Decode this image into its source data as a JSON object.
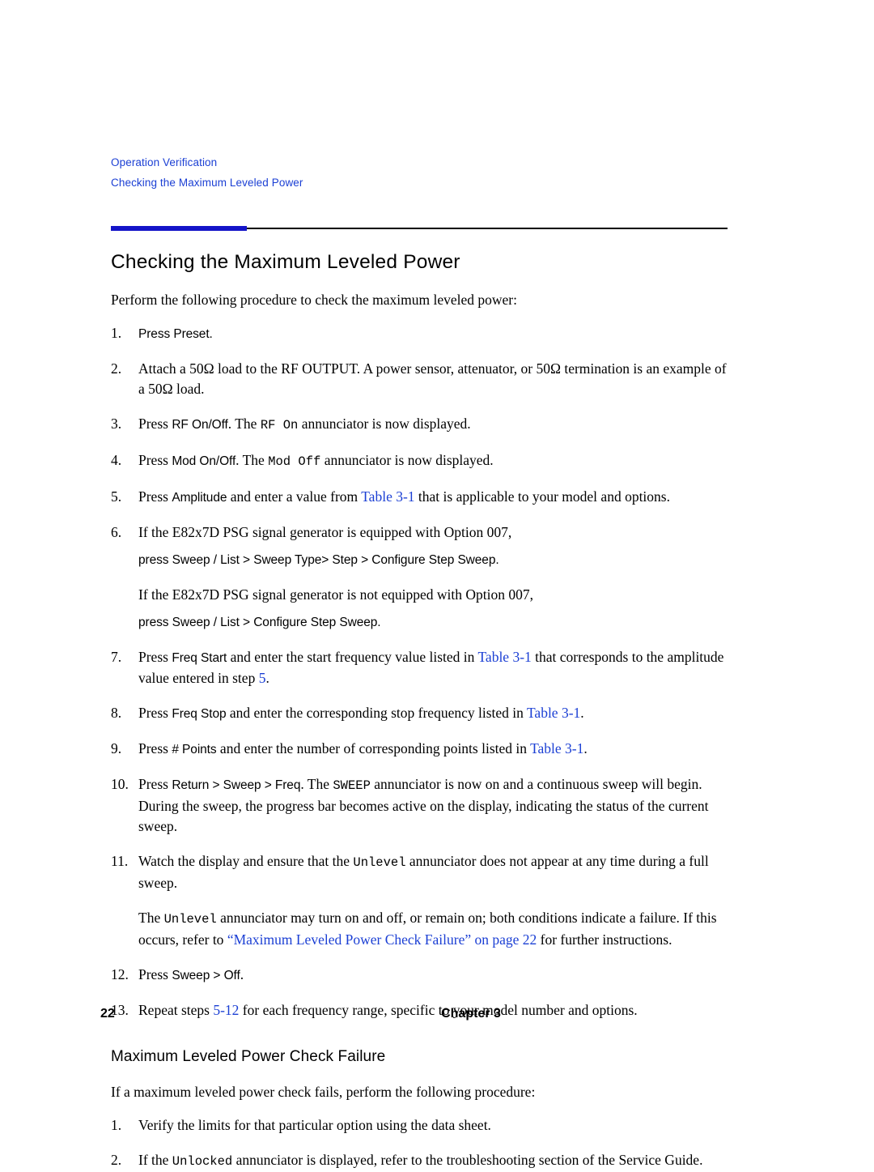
{
  "header": {
    "line1": "Operation Verification",
    "line2": "Checking the Maximum Leveled Power"
  },
  "title": "Checking the Maximum Leveled Power",
  "intro": "Perform the following procedure to check the maximum leveled power:",
  "steps": {
    "n1": "1.",
    "s1_a": "Press Preset.",
    "n2": "2.",
    "s2_a": "Attach a 50Ω load to the RF OUTPUT. A power sensor, attenuator, or 50Ω termination is an example of a 50Ω load.",
    "n3": "3.",
    "s3_a": "Press ",
    "s3_key": "RF On/Off",
    "s3_b": ". The ",
    "s3_mono": "RF On",
    "s3_c": " annunciator is now displayed.",
    "n4": "4.",
    "s4_a": "Press ",
    "s4_key": "Mod On/Off",
    "s4_b": ". The ",
    "s4_mono": "Mod Off",
    "s4_c": " annunciator is now displayed.",
    "n5": "5.",
    "s5_a": "Press ",
    "s5_key": "Amplitude",
    "s5_b": " and enter a value from ",
    "s5_link": "Table 3-1",
    "s5_c": " that is applicable to your model and options.",
    "n6": "6.",
    "s6_a": "If the E82x7D PSG signal generator is equipped with Option 007,",
    "s6_keys1": "press Sweep / List > Sweep Type> Step > Configure Step Sweep.",
    "s6_b": "If the E82x7D PSG signal generator is not equipped with Option 007,",
    "s6_keys2": "press Sweep / List > Configure Step Sweep.",
    "n7": "7.",
    "s7_a": "Press ",
    "s7_key": "Freq Start",
    "s7_b": " and enter the start frequency value listed in ",
    "s7_link": "Table 3-1",
    "s7_c": " that corresponds to the amplitude value entered in step ",
    "s7_link2": "5",
    "s7_d": ".",
    "n8": "8.",
    "s8_a": "Press ",
    "s8_key": "Freq Stop",
    "s8_b": " and enter the corresponding stop frequency listed in ",
    "s8_link": "Table 3-1",
    "s8_c": ".",
    "n9": "9.",
    "s9_a": "Press ",
    "s9_key": "# Points",
    "s9_b": " and enter the number of corresponding points listed in ",
    "s9_link": "Table 3-1",
    "s9_c": ".",
    "n10": "10.",
    "s10_a": "Press ",
    "s10_key": "Return > Sweep > Freq",
    "s10_b": ". The ",
    "s10_mono": "SWEEP",
    "s10_c": " annunciator is now on and a continuous sweep will begin. During the sweep, the progress bar becomes active on the display, indicating the status of the current sweep.",
    "n11": "11.",
    "s11_a": "Watch the display and ensure that the ",
    "s11_mono": "Unlevel",
    "s11_b": " annunciator does not appear at any time during a full sweep.",
    "s11_p2_a": "The ",
    "s11_p2_mono": "Unlevel",
    "s11_p2_b": " annunciator may turn on and off, or remain on; both conditions indicate a failure. If this occurs, refer to ",
    "s11_p2_link": "“Maximum Leveled Power Check Failure” on page 22",
    "s11_p2_c": " for further instructions.",
    "n12": "12.",
    "s12_a": "Press ",
    "s12_key": "Sweep > Off",
    "s12_b": ".",
    "n13": "13.",
    "s13_a": "Repeat steps ",
    "s13_link": "5-12",
    "s13_b": " for each frequency range, specific to your model number and options."
  },
  "subsection": {
    "title": "Maximum Leveled Power Check Failure",
    "intro": "If a maximum leveled power check fails, perform the following procedure:",
    "n1": "1.",
    "s1": "Verify the limits for that particular option using the data sheet.",
    "n2": "2.",
    "s2_a": "If the ",
    "s2_mono": "Unlocked",
    "s2_b": " annunciator is displayed, refer to the troubleshooting section of the Service Guide."
  },
  "footer": {
    "page_number": "22",
    "chapter": "Chapter 3"
  }
}
